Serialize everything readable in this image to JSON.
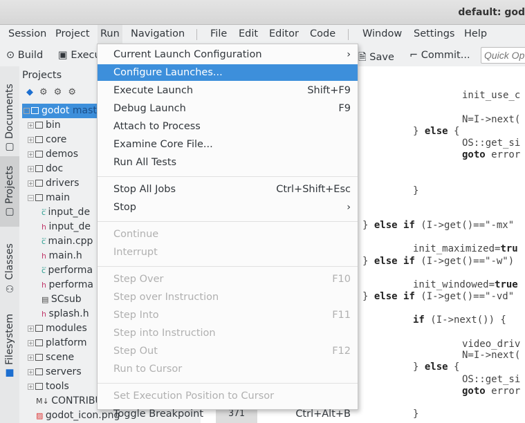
{
  "title": "default: god",
  "menubar": [
    "Session",
    "Project",
    "Run",
    "Navigation",
    "File",
    "Edit",
    "Editor",
    "Code",
    "Window",
    "Settings",
    "Help"
  ],
  "toolbar": {
    "build": "Build",
    "execute": "Execu",
    "save": "Save",
    "commit": "Commit...",
    "quick_open_placeholder": "Quick Op"
  },
  "side_tabs": [
    "Documents",
    "Projects",
    "Classes",
    "Filesystem"
  ],
  "projects": {
    "title": "Projects",
    "tree": [
      {
        "label": "godot",
        "extra": "mast",
        "type": "root"
      },
      {
        "label": "bin",
        "type": "folder"
      },
      {
        "label": "core",
        "type": "folder"
      },
      {
        "label": "demos",
        "type": "folder"
      },
      {
        "label": "doc",
        "type": "folder"
      },
      {
        "label": "drivers",
        "type": "folder"
      },
      {
        "label": "main",
        "type": "folder-open"
      },
      {
        "label": "input_de",
        "type": "cpp"
      },
      {
        "label": "input_de",
        "type": "h"
      },
      {
        "label": "main.cpp",
        "type": "cpp"
      },
      {
        "label": "main.h",
        "type": "h"
      },
      {
        "label": "performa",
        "type": "cpp"
      },
      {
        "label": "performa",
        "type": "h"
      },
      {
        "label": "SCsub",
        "type": "file"
      },
      {
        "label": "splash.h",
        "type": "h"
      },
      {
        "label": "modules",
        "type": "folder"
      },
      {
        "label": "platform",
        "type": "folder"
      },
      {
        "label": "scene",
        "type": "folder"
      },
      {
        "label": "servers",
        "type": "folder"
      },
      {
        "label": "tools",
        "type": "folder"
      },
      {
        "label": "CONTRIBU",
        "type": "md"
      },
      {
        "label": "godot_icon.png",
        "type": "image"
      }
    ]
  },
  "run_menu": [
    {
      "label": "Current Launch Configuration",
      "submenu": true
    },
    {
      "label": "Configure Launches...",
      "highlighted": true
    },
    {
      "label": "Execute Launch",
      "shortcut": "Shift+F9"
    },
    {
      "label": "Debug Launch",
      "shortcut": "F9"
    },
    {
      "label": "Attach to Process"
    },
    {
      "label": "Examine Core File..."
    },
    {
      "label": "Run All Tests"
    },
    {
      "label": "Stop All Jobs",
      "shortcut": "Ctrl+Shift+Esc"
    },
    {
      "label": "Stop",
      "submenu": true
    },
    {
      "label": "Continue",
      "disabled": true
    },
    {
      "label": "Interrupt",
      "disabled": true
    },
    {
      "label": "Step Over",
      "shortcut": "F10",
      "disabled": true
    },
    {
      "label": "Step over Instruction",
      "disabled": true
    },
    {
      "label": "Step Into",
      "shortcut": "F11",
      "disabled": true
    },
    {
      "label": "Step into Instruction",
      "disabled": true
    },
    {
      "label": "Step Out",
      "shortcut": "F12",
      "disabled": true
    },
    {
      "label": "Run to Cursor",
      "disabled": true
    },
    {
      "label": "Set Execution Position to Cursor",
      "disabled": true
    },
    {
      "label": "Toggle Breakpoint",
      "shortcut": "Ctrl+Alt+B"
    }
  ],
  "code": [
    "init_use_c",
    "N=I->next(",
    "} else {",
    "OS::get_si",
    "goto error",
    "}",
    "} else if (I->get()==\"-mx\"",
    "init_maximized=tru",
    "} else if (I->get()==\"-w\")",
    "init_windowed=true",
    "} else if (I->get()==\"-vd\"",
    "if (I->next()) {",
    "video_driv",
    "N=I->next(",
    "} else {",
    "OS::get_si",
    "goto error",
    "}"
  ],
  "line_number": "371",
  "colors": {
    "accent": "#3d8fdb"
  }
}
